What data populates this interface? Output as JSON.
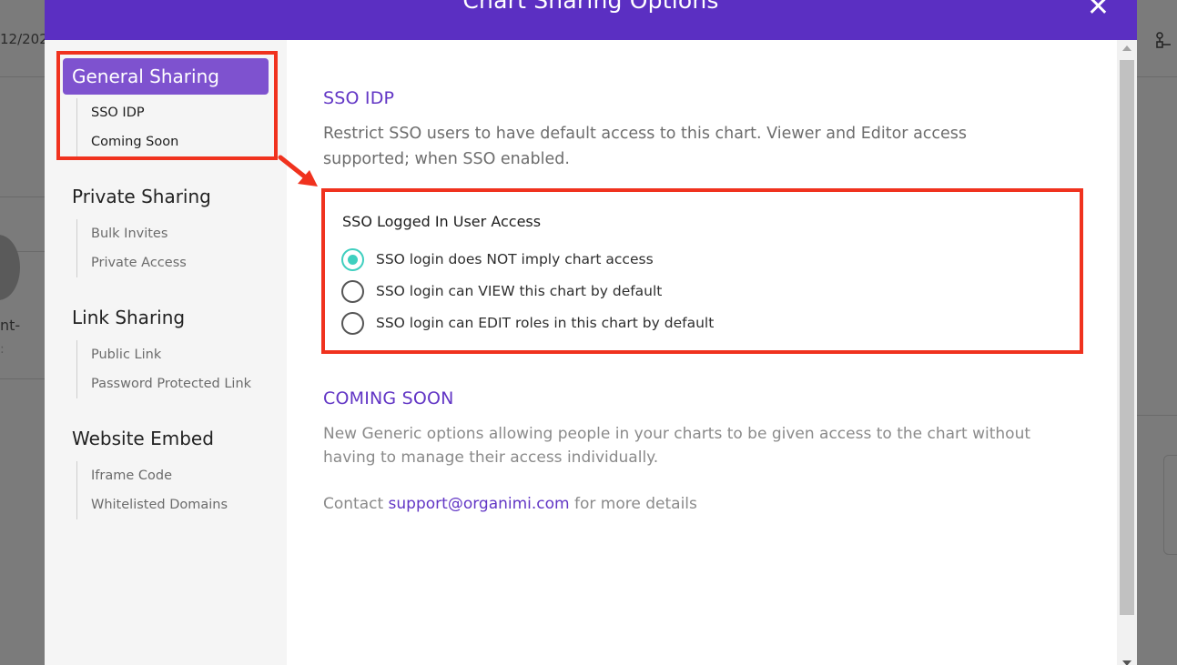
{
  "background": {
    "date_fragment": "12/202",
    "text_fragment_1": "nt-",
    "text_fragment_2": ":",
    "right_icon": "hierarchy-icon"
  },
  "modal": {
    "title": "Chart Sharing Options",
    "close_label": "✕",
    "header_color": "#5b2fc2"
  },
  "sidebar": {
    "active_item": "General Sharing",
    "general_sub": [
      "SSO IDP",
      "Coming Soon"
    ],
    "groups": [
      {
        "title": "Private Sharing",
        "items": [
          "Bulk Invites",
          "Private Access"
        ]
      },
      {
        "title": "Link Sharing",
        "items": [
          "Public Link",
          "Password Protected Link"
        ]
      },
      {
        "title": "Website Embed",
        "items": [
          "Iframe Code",
          "Whitelisted Domains"
        ]
      }
    ],
    "active_color": "#7e52cf"
  },
  "content": {
    "sso_title": "SSO IDP",
    "sso_desc": "Restrict SSO users to have default access to this chart. Viewer and Editor access supported; when SSO enabled.",
    "access_title": "SSO Logged In User Access",
    "options": [
      {
        "label": "SSO login does NOT imply chart access",
        "selected": true
      },
      {
        "label": "SSO login can VIEW this chart by default",
        "selected": false
      },
      {
        "label": "SSO login can EDIT roles in this chart by default",
        "selected": false
      }
    ],
    "coming_title": "COMING SOON",
    "coming_desc": "New Generic options allowing people in your charts to be given access to the chart without having to manage their access individually.",
    "contact_prefix": "Contact",
    "contact_email": "support@organimi.com",
    "contact_suffix": "for more details",
    "accent_color": "#6236c5",
    "radio_color": "#3fcfbf"
  },
  "annotation": {
    "color": "#f0321e"
  }
}
